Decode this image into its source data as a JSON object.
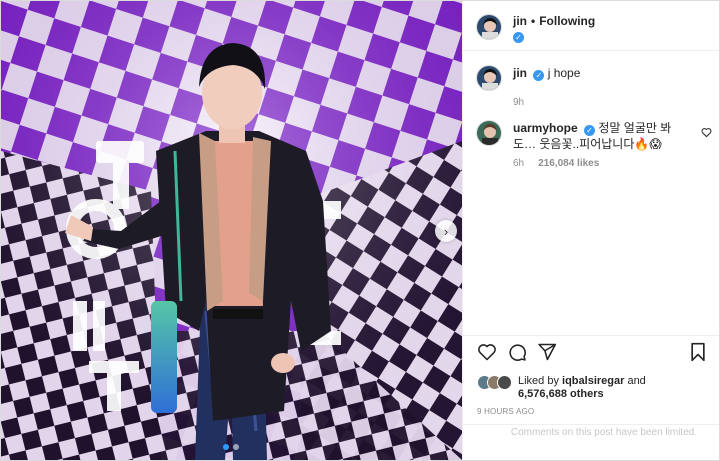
{
  "post": {
    "author": "jin",
    "separator": "•",
    "follow_status": "Following",
    "verified_mark": "✓"
  },
  "caption": {
    "username": "jin",
    "text": "j hope",
    "time": "9h"
  },
  "comment": {
    "username": "uarmyhope",
    "text": "정말 얼굴만 봐도… 웃음꽃..피어납니다🔥😱",
    "time": "6h",
    "likes": "216,084 likes"
  },
  "likes": {
    "prefix": "Liked by ",
    "user": "iqbalsiregar",
    "and": " and",
    "others": "6,576,688 others"
  },
  "timestamp": "9 HOURS AGO",
  "comments_notice": "Comments on this post have been limited.",
  "carousel": {
    "next_glyph": "›",
    "slides": 2,
    "active_slide": 1
  },
  "icons": [
    "heart-icon",
    "comment-icon",
    "share-icon",
    "bookmark-icon",
    "verified-icon",
    "chevron-right-icon"
  ],
  "colors": {
    "accent": "#3897f0",
    "purple": "#8a2bd6",
    "text": "#262626",
    "muted": "#8e8e8e"
  }
}
